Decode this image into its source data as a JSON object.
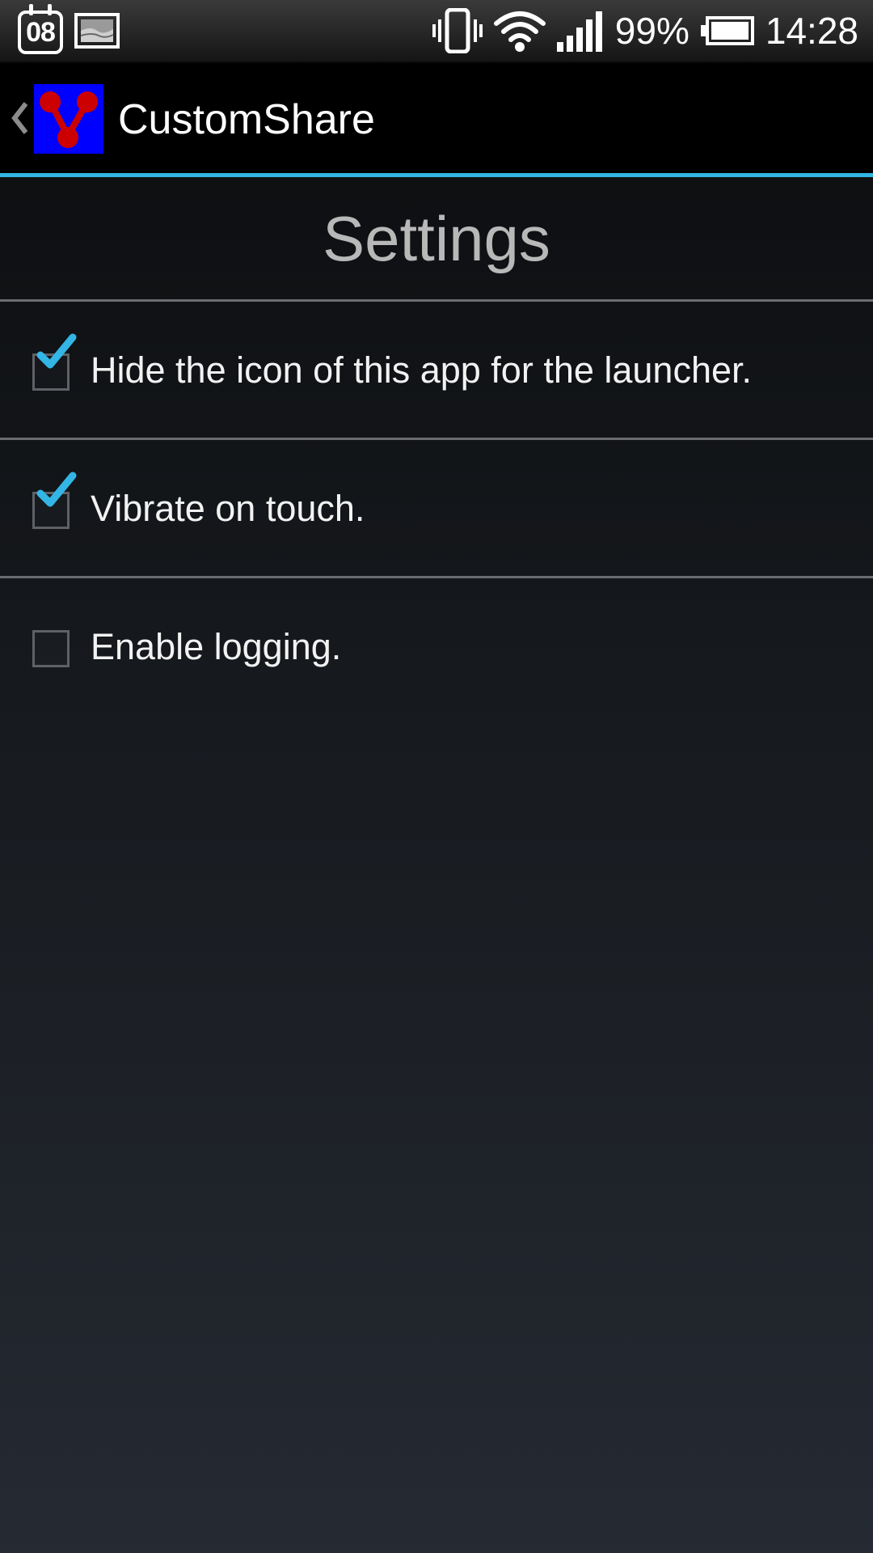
{
  "status_bar": {
    "calendar_day": "08",
    "battery_percent": "99%",
    "time": "14:28",
    "icons": [
      "calendar-icon",
      "image-notification-icon",
      "vibrate-icon",
      "wifi-icon",
      "signal-icon",
      "battery-icon"
    ]
  },
  "action_bar": {
    "title": "CustomShare",
    "accent_color": "#33b5e5",
    "app_icon_bg": "#0000ff",
    "app_icon_fg": "#cc0000"
  },
  "page": {
    "heading": "Settings"
  },
  "settings": [
    {
      "label": "Hide the icon of this app for the launcher.",
      "checked": true
    },
    {
      "label": "Vibrate on touch.",
      "checked": true
    },
    {
      "label": "Enable logging.",
      "checked": false
    }
  ]
}
